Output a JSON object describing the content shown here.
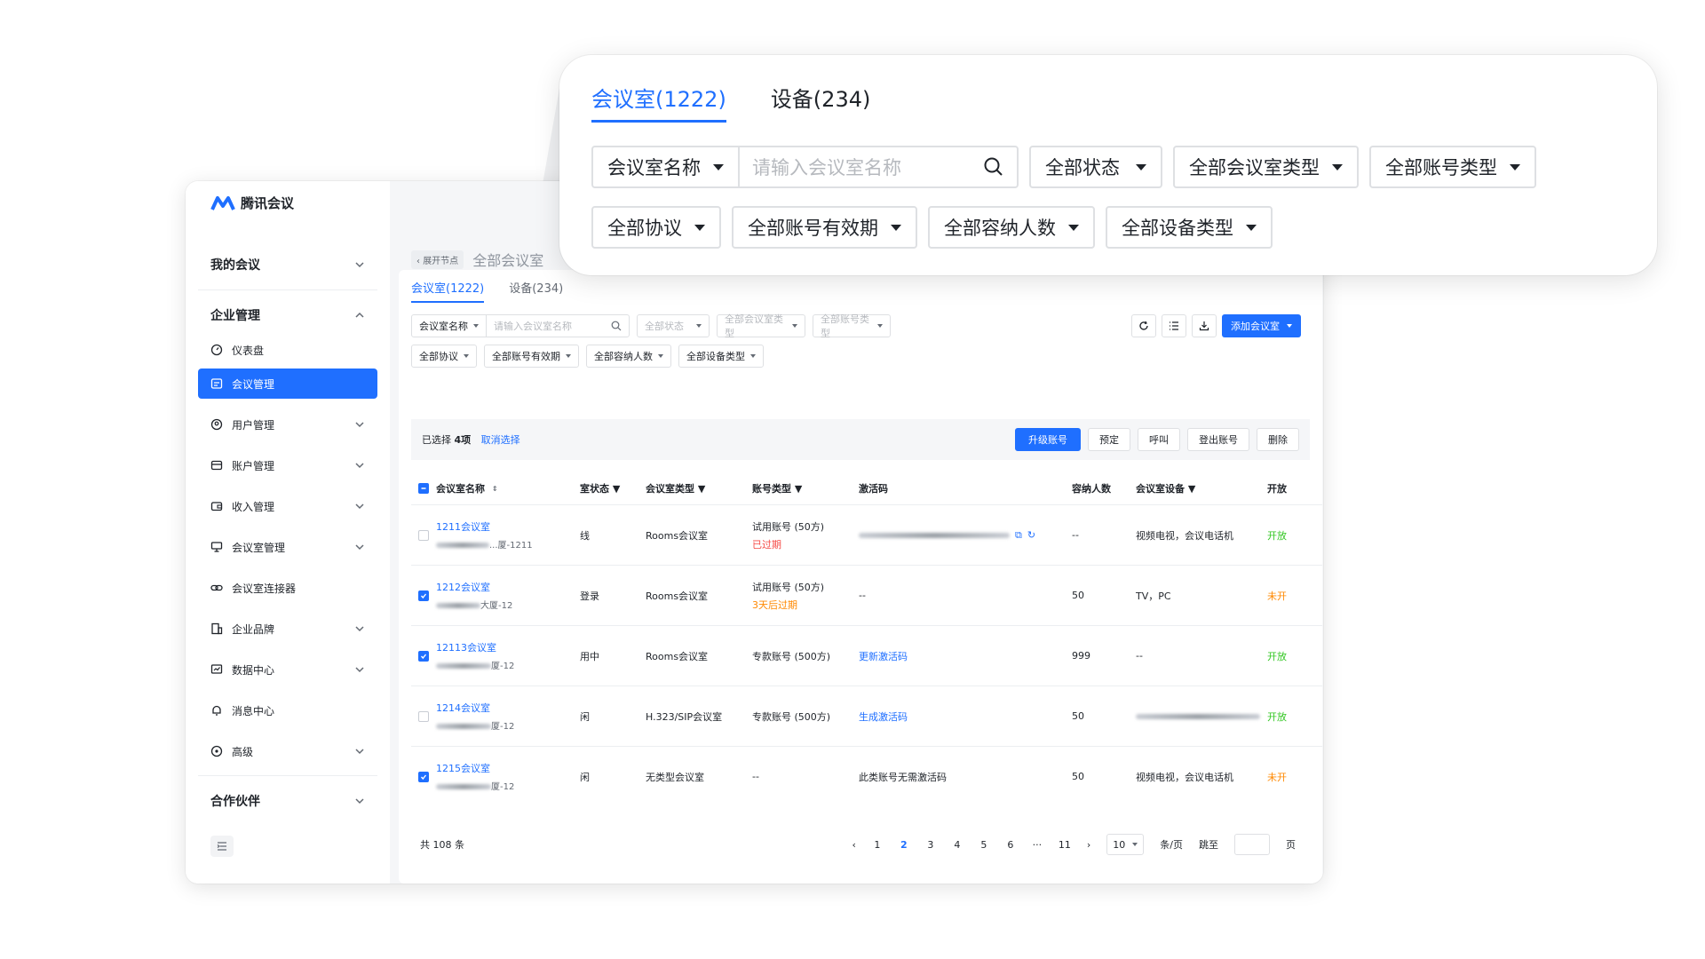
{
  "app": {
    "name": "腾讯会议"
  },
  "sidebar": {
    "groups": [
      {
        "label": "我的会议"
      },
      {
        "label": "企业管理"
      },
      {
        "label": "合作伙伴"
      }
    ],
    "items": [
      {
        "label": "仪表盘",
        "icon": "dashboard-icon"
      },
      {
        "label": "会议管理",
        "icon": "meeting-room-icon"
      },
      {
        "label": "用户管理",
        "icon": "user-icon"
      },
      {
        "label": "账户管理",
        "icon": "account-icon"
      },
      {
        "label": "收入管理",
        "icon": "wallet-icon"
      },
      {
        "label": "会议室管理",
        "icon": "projector-icon"
      },
      {
        "label": "会议室连接器",
        "icon": "link-icon"
      },
      {
        "label": "企业品牌",
        "icon": "building-icon"
      },
      {
        "label": "数据中心",
        "icon": "chart-icon"
      },
      {
        "label": "消息中心",
        "icon": "bell-icon"
      },
      {
        "label": "高级",
        "icon": "advanced-icon"
      }
    ]
  },
  "breadcrumb": {
    "back": "展开节点",
    "current": "全部会议室"
  },
  "tabs": [
    {
      "label": "会议室(1222)"
    },
    {
      "label": "设备(234)"
    }
  ],
  "filters": {
    "name_select": "会议室名称",
    "search_placeholder": "请输入会议室名称",
    "row1": [
      "全部状态",
      "全部会议室类型",
      "全部账号类型"
    ],
    "row2": [
      "全部协议",
      "全部账号有效期",
      "全部容纳人数",
      "全部设备类型"
    ]
  },
  "toolbar": {
    "add_label": "添加会议室"
  },
  "selection": {
    "prefix": "已选择",
    "count": "4项",
    "cancel": "取消选择",
    "actions": [
      "升级账号",
      "预定",
      "呼叫",
      "登出账号",
      "删除"
    ]
  },
  "table": {
    "headers": [
      "会议室名称",
      "室状态",
      "会议室类型",
      "账号类型",
      "激活码",
      "容纳人数",
      "会议室设备",
      "开放"
    ],
    "rows": [
      {
        "name": "1211会议室",
        "addr": "...厦-1211",
        "status": "线",
        "type": "Rooms会议室",
        "account": "试用账号 (50方)",
        "account_note": "已过期",
        "note_color": "red",
        "code": "",
        "code_kind": "blur",
        "cap": "--",
        "devices": "视频电视，会议电话机",
        "open": "开放",
        "open_color": "green",
        "checked": false
      },
      {
        "name": "1212会议室",
        "addr": "大厦-12",
        "status": "登录",
        "type": "Rooms会议室",
        "account": "试用账号 (50方)",
        "account_note": "3天后过期",
        "note_color": "orange",
        "code": "--",
        "code_kind": "text",
        "cap": "50",
        "devices": "TV，PC",
        "open": "未开",
        "open_color": "orange",
        "checked": true
      },
      {
        "name": "12113会议室",
        "addr": "厦-12",
        "status": "用中",
        "type": "Rooms会议室",
        "account": "专款账号 (500方)",
        "account_note": "",
        "note_color": "",
        "code": "更新激活码",
        "code_kind": "link",
        "cap": "999",
        "devices": "--",
        "open": "开放",
        "open_color": "green",
        "checked": true
      },
      {
        "name": "1214会议室",
        "addr": "厦-12",
        "status": "闲",
        "type": "H.323/SIP会议室",
        "account": "专款账号 (500方)",
        "account_note": "",
        "note_color": "",
        "code": "生成激活码",
        "code_kind": "link",
        "cap": "50",
        "devices": "",
        "open": "开放",
        "open_color": "green",
        "checked": false
      },
      {
        "name": "1215会议室",
        "addr": "厦-12",
        "status": "闲",
        "type": "无类型会议室",
        "account": "--",
        "account_note": "",
        "note_color": "",
        "code": "此类账号无需激活码",
        "code_kind": "text",
        "cap": "50",
        "devices": "视频电视，会议电话机",
        "open": "未开",
        "open_color": "orange",
        "checked": true
      }
    ]
  },
  "pagination": {
    "total": "共 108 条",
    "pages": [
      "1",
      "2",
      "3",
      "4",
      "5",
      "6",
      "···",
      "11"
    ],
    "current": "2",
    "page_size": "10",
    "per_page": "条/页",
    "jump": "跳至",
    "page_unit": "页"
  },
  "popup": {
    "tabs": [
      "会议室(1222)",
      "设备(234)"
    ],
    "name_select": "会议室名称",
    "search_placeholder": "请输入会议室名称",
    "row1": [
      "全部状态",
      "全部会议室类型",
      "全部账号类型"
    ],
    "row2": [
      "全部协议",
      "全部账号有效期",
      "全部容纳人数",
      "全部设备类型"
    ]
  },
  "colors": {
    "accent": "#1f6fff",
    "danger": "#f54a45",
    "warning": "#ff8800",
    "success": "#34c724"
  }
}
